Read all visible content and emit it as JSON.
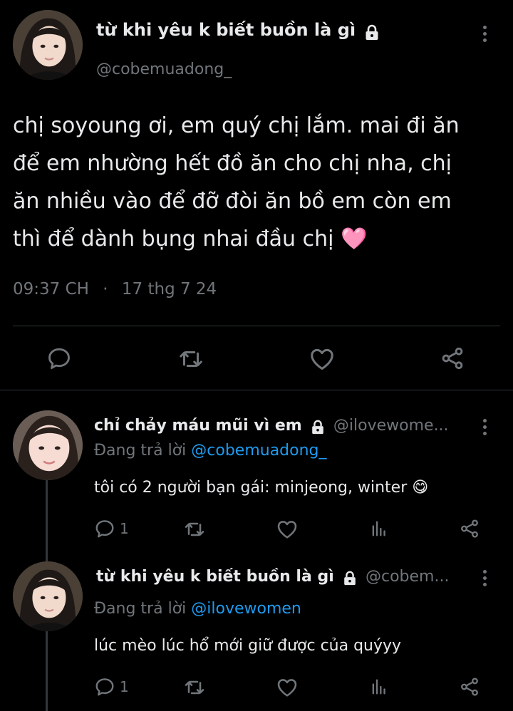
{
  "main_tweet": {
    "display_name": "từ khi yêu k biết buồn là gì",
    "handle": "@cobemuadong_",
    "text_lines": [
      "chị soyoung ơi, em quý chị lắm. mai đi ăn",
      "để em nhường hết đồ ăn cho chị nha, chị",
      "ăn nhiều vào để đỡ đòi ăn bồ em còn em",
      "thì để dành bụng nhai đầu chị"
    ],
    "emoji": "🩷",
    "time": "09:37 CH",
    "separator": "·",
    "date": "17 thg 7 24"
  },
  "replies": [
    {
      "display_name": "chỉ chảy máu mũi vì em",
      "handle": "@ilovewome...",
      "replying_prefix": "Đang trả lời",
      "replying_to": "@cobemuadong_",
      "text": "tôi có 2 người bạn gái: minjeong, winter",
      "emoji": "😋",
      "reply_count": "1"
    },
    {
      "display_name": "từ khi yêu k biết buồn là gì",
      "handle": "@cobem...",
      "replying_prefix": "Đang trả lời",
      "replying_to": "@ilovewomen",
      "text": "lúc mèo lúc hổ mới giữ được của quýyy",
      "reply_count": "1"
    }
  ],
  "icons": [
    "lock-icon",
    "more-icon",
    "reply-icon",
    "retweet-icon",
    "like-icon",
    "share-icon",
    "views-icon"
  ],
  "colors": {
    "background": "#000000",
    "text": "#e7e9ea",
    "muted": "#71767b",
    "link": "#1d9bf0",
    "divider": "#2f3336"
  }
}
